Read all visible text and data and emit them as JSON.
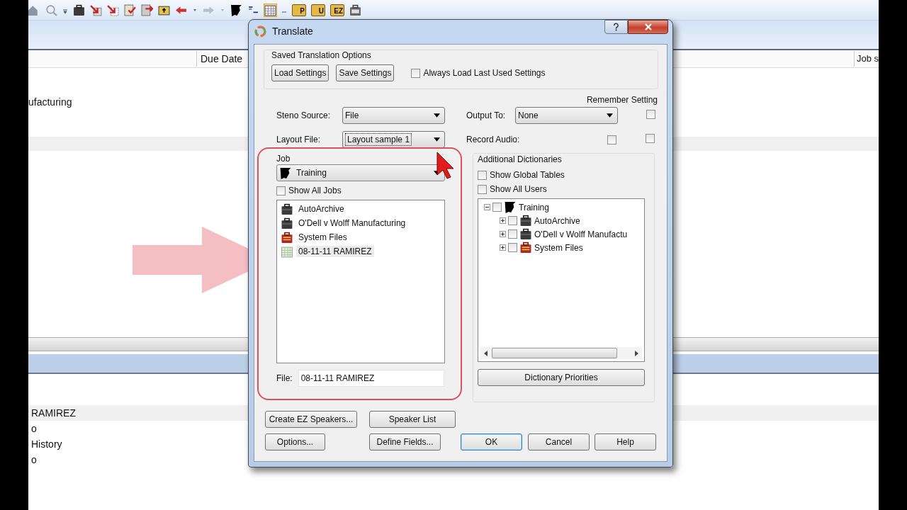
{
  "toolbar": {
    "folder_labels": [
      "P",
      "U",
      "EZ"
    ]
  },
  "table": {
    "columns": [
      "Due Date",
      "Job s"
    ],
    "rows": [
      {
        "column_1": "ufacturing"
      }
    ]
  },
  "lower_list": {
    "rows": [
      {
        "text": "RAMIREZ",
        "selected": true
      },
      {
        "text": "o",
        "selected": false
      },
      {
        "text": "History",
        "selected": false
      },
      {
        "text": "o",
        "selected": false
      }
    ]
  },
  "dialog": {
    "title": "Translate",
    "saved_options": {
      "legend": "Saved Translation Options",
      "buttons": [
        "Load Settings",
        "Save Settings"
      ],
      "always_load": {
        "label": "Always Load Last Used Settings",
        "checked": false
      }
    },
    "remember_header": "Remember Setting",
    "steno_source": {
      "label": "Steno Source:",
      "value": "File"
    },
    "layout_file": {
      "label": "Layout File:",
      "value": "Layout sample 1",
      "focused": true
    },
    "output_to": {
      "label": "Output To:",
      "value": "None",
      "remember": false
    },
    "record_audio": {
      "label": "Record Audio:",
      "checked": false,
      "remember": false
    },
    "job": {
      "legend": "Job",
      "selected_job": "Training",
      "show_all_jobs": {
        "label": "Show All Jobs",
        "checked": false
      },
      "items": [
        {
          "label": "AutoArchive",
          "kind": "job",
          "selected": false
        },
        {
          "label": "O'Dell v Wolff Manufacturing",
          "kind": "job",
          "selected": false
        },
        {
          "label": "System Files",
          "kind": "system",
          "selected": false
        },
        {
          "label": "08-11-11 RAMIREZ",
          "kind": "file",
          "selected": true
        }
      ],
      "file": {
        "label": "File:",
        "value": "08-11-11 RAMIREZ"
      }
    },
    "dictionaries": {
      "legend": "Additional Dictionaries",
      "show_global_tables": {
        "label": "Show Global Tables",
        "checked": false
      },
      "show_all_users": {
        "label": "Show All Users",
        "checked": false
      },
      "tree": [
        {
          "label": "Training",
          "kind": "user",
          "expanded": true,
          "checked": false,
          "children": [
            {
              "label": "AutoArchive",
              "kind": "job",
              "expanded": false,
              "checked": false
            },
            {
              "label": "O'Dell v Wolff Manufactu",
              "kind": "job",
              "expanded": false,
              "checked": false
            },
            {
              "label": "System Files",
              "kind": "system",
              "expanded": false,
              "checked": false
            }
          ]
        }
      ],
      "priorities_button": "Dictionary Priorities"
    },
    "buttons_row_1": [
      {
        "label": "Create EZ Speakers...",
        "default": false
      },
      {
        "label": "Speaker List",
        "default": false
      }
    ],
    "buttons_row_2": [
      {
        "label": "Options...",
        "default": false
      },
      {
        "label": "Define Fields...",
        "default": false
      },
      {
        "label": "OK",
        "default": true
      },
      {
        "label": "Cancel",
        "default": false
      },
      {
        "label": "Help",
        "default": false
      }
    ]
  }
}
